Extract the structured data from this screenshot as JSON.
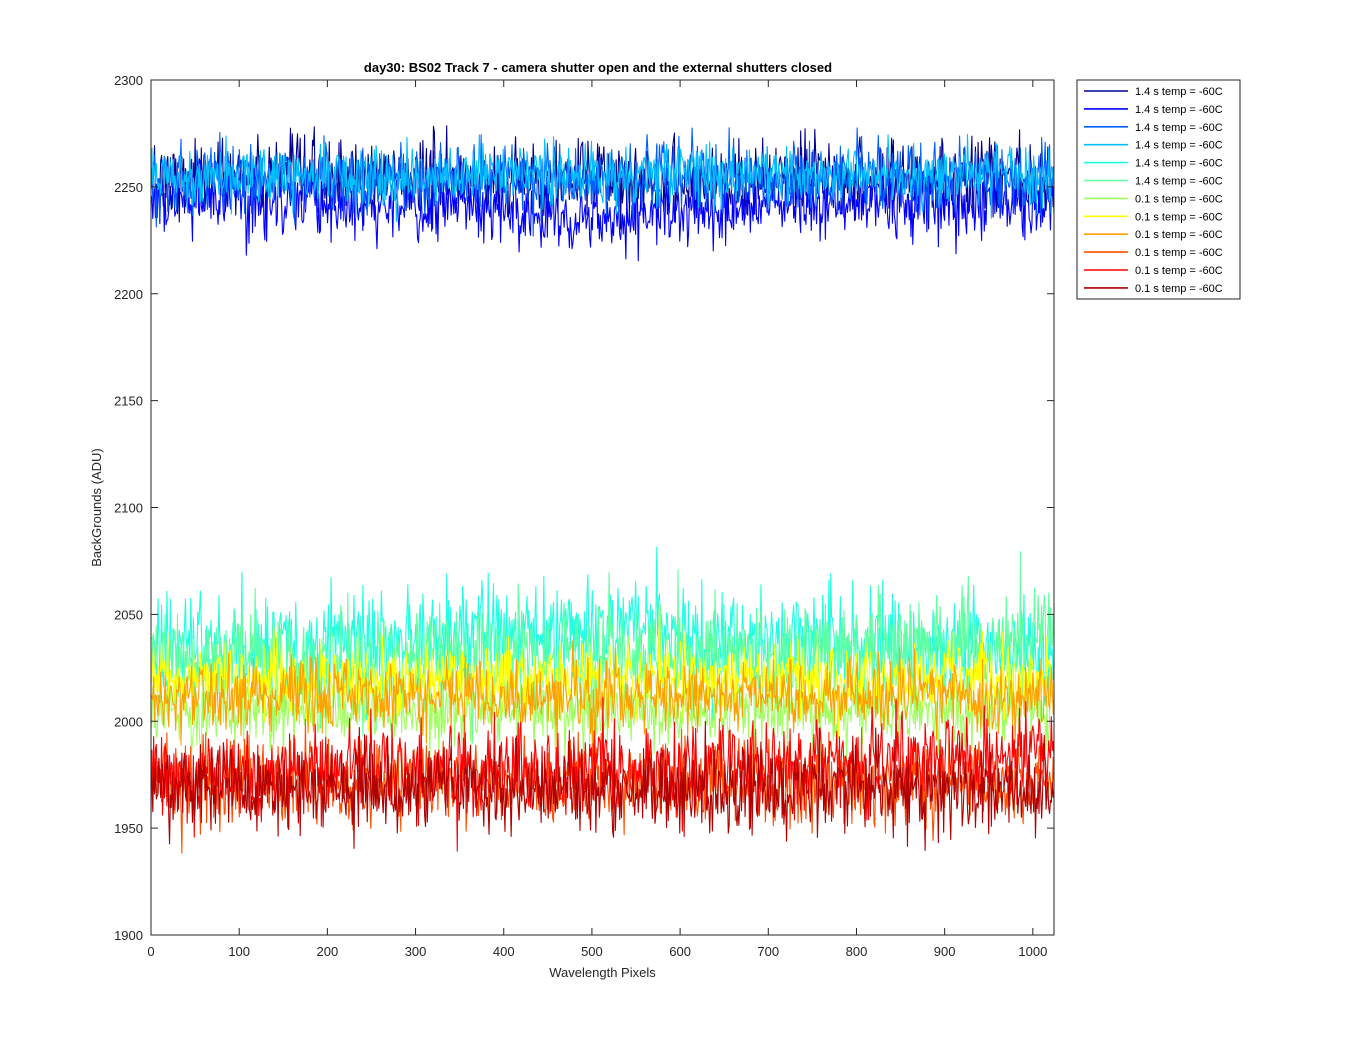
{
  "chart_data": {
    "type": "line",
    "title": "day30: BS02  Track 7 - camera shutter open and the external shutters closed",
    "xlabel": "Wavelength Pixels",
    "ylabel": "BackGrounds (ADU)",
    "xlim": [
      0,
      1024
    ],
    "ylim": [
      1900,
      2300
    ],
    "xticks": [
      0,
      100,
      200,
      300,
      400,
      500,
      600,
      700,
      800,
      900,
      1000
    ],
    "yticks": [
      1900,
      1950,
      2000,
      2050,
      2100,
      2150,
      2200,
      2250,
      2300
    ],
    "grid": false,
    "legend_position": "outside-top-right",
    "x_points": 1024,
    "series": [
      {
        "name": "1.4 s temp = -60C",
        "color": "#00008f",
        "mean": 2254,
        "noise": 9,
        "trend": "flat"
      },
      {
        "name": "1.4 s temp = -60C",
        "color": "#0000ff",
        "mean": 2243,
        "noise": 8,
        "trend": "dip-center"
      },
      {
        "name": "1.4 s temp = -60C",
        "color": "#0060ff",
        "mean": 2254,
        "noise": 8,
        "trend": "flat"
      },
      {
        "name": "1.4 s temp = -60C",
        "color": "#00c0ff",
        "mean": 2256,
        "noise": 7,
        "trend": "flat"
      },
      {
        "name": "1.4 s temp = -60C",
        "color": "#20ffe0",
        "mean": 2035,
        "noise": 12,
        "trend": "bump-center"
      },
      {
        "name": "1.4 s temp = -60C",
        "color": "#60ffa0",
        "mean": 2028,
        "noise": 12,
        "trend": "rise-right"
      },
      {
        "name": "0.1 s temp = -60C",
        "color": "#a0ff60",
        "mean": 2005,
        "noise": 8,
        "trend": "flat"
      },
      {
        "name": "0.1 s temp = -60C",
        "color": "#ffff00",
        "mean": 2020,
        "noise": 8,
        "trend": "flat"
      },
      {
        "name": "0.1 s temp = -60C",
        "color": "#ffa000",
        "mean": 2012,
        "noise": 8,
        "trend": "flat"
      },
      {
        "name": "0.1 s temp = -60C",
        "color": "#ff5000",
        "mean": 1972,
        "noise": 10,
        "trend": "flat"
      },
      {
        "name": "0.1 s temp = -60C",
        "color": "#ff0000",
        "mean": 1976,
        "noise": 10,
        "trend": "rise-right"
      },
      {
        "name": "0.1 s temp = -60C",
        "color": "#b00000",
        "mean": 1968,
        "noise": 10,
        "trend": "flat"
      }
    ]
  }
}
